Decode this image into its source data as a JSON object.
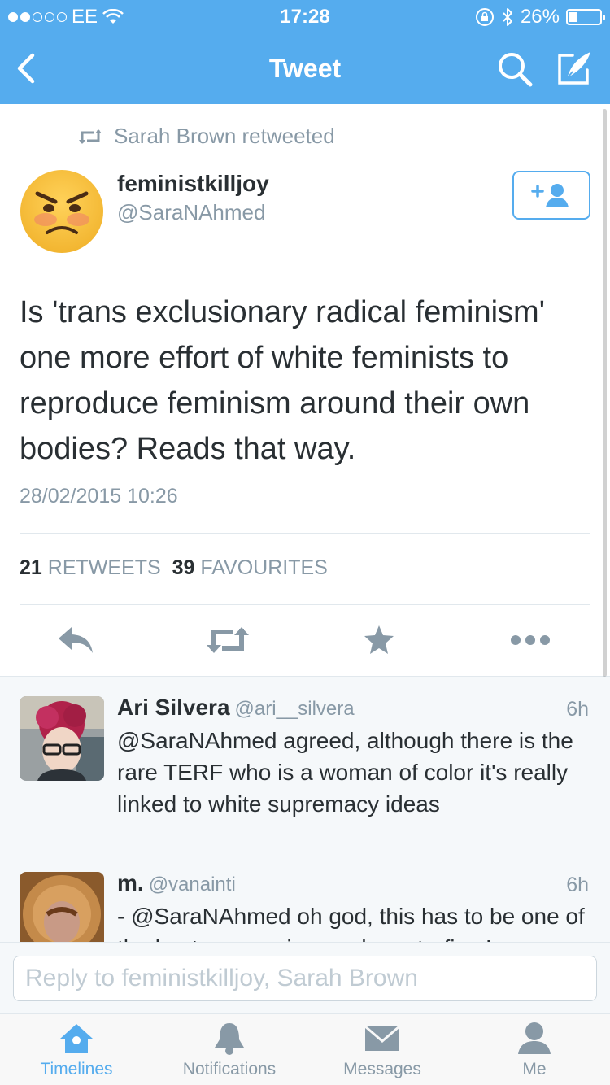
{
  "status_bar": {
    "carrier": "EE",
    "time": "17:28",
    "battery": "26%",
    "battery_level": 0.26,
    "signal_bars": 2
  },
  "nav": {
    "title": "Tweet",
    "back_icon": "chevron-left-icon",
    "search_icon": "search-icon",
    "compose_icon": "compose-icon"
  },
  "tweet": {
    "retweeted_by": "Sarah Brown retweeted",
    "author_name": "feministkilljoy",
    "author_handle": "@SaraNAhmed",
    "text": "Is 'trans exclusionary radical feminism' one more effort of white feminists to reproduce feminism around their own bodies? Reads that way.",
    "timestamp": "28/02/2015 10:26",
    "retweet_count": "21",
    "retweet_label": "RETWEETS",
    "favourite_count": "39",
    "favourite_label": "FAVOURITES"
  },
  "replies": [
    {
      "name": "Ari Silvera",
      "handle": "@ari__silvera",
      "time": "6h",
      "text": "@SaraNAhmed agreed, although there is the rare TERF who is a woman of color it's really linked to white supremacy ideas"
    },
    {
      "name": "m.",
      "handle": "@vanainti",
      "time": "6h",
      "text": "- @SaraNAhmed oh god, this has to be one of the best summaries made on terfism! ..."
    }
  ],
  "reply_bar": {
    "placeholder": "Reply to feministkilljoy, Sarah Brown"
  },
  "tabs": [
    {
      "label": "Timelines",
      "icon": "home-icon",
      "active": true
    },
    {
      "label": "Notifications",
      "icon": "bell-icon",
      "active": false
    },
    {
      "label": "Messages",
      "icon": "envelope-icon",
      "active": false
    },
    {
      "label": "Me",
      "icon": "person-icon",
      "active": false
    }
  ],
  "colors": {
    "accent": "#55acee",
    "secondary_text": "#8899a6",
    "action_icons": "#8899a6"
  }
}
